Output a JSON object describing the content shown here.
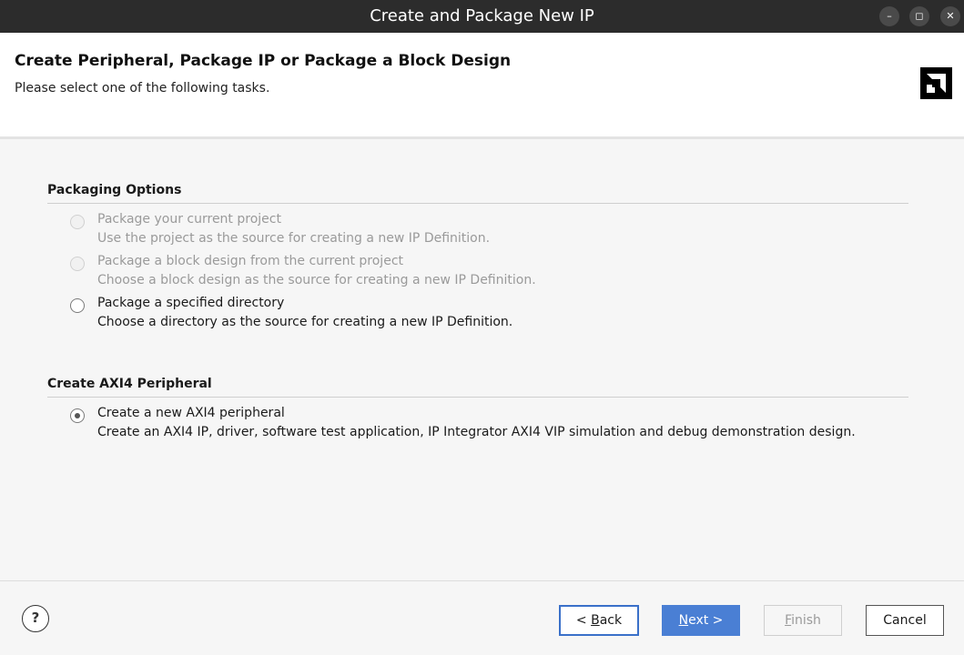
{
  "window": {
    "title": "Create and Package New IP",
    "controls": [
      "minimize",
      "maximize",
      "close"
    ]
  },
  "header": {
    "title": "Create Peripheral, Package IP or Package a Block Design",
    "subtitle": "Please select one of the following tasks.",
    "logo": "amd-logo"
  },
  "sections": [
    {
      "title": "Packaging Options",
      "options": [
        {
          "label": "Package your current project",
          "description": "Use the project as the source for creating a new IP Definition.",
          "enabled": false,
          "selected": false
        },
        {
          "label": "Package a block design from the current project",
          "description": "Choose a block design as the source for creating a new IP Definition.",
          "enabled": false,
          "selected": false
        },
        {
          "label": "Package a specified directory",
          "description": "Choose a directory as the source for creating a new IP Definition.",
          "enabled": true,
          "selected": false
        }
      ]
    },
    {
      "title": "Create AXI4 Peripheral",
      "options": [
        {
          "label": "Create a new AXI4 peripheral",
          "description": "Create an AXI4 IP, driver, software test application, IP Integrator AXI4 VIP simulation and debug demonstration design.",
          "enabled": true,
          "selected": true
        }
      ]
    }
  ],
  "footer": {
    "help_label": "?",
    "back_prefix": "< ",
    "back_mnemonic": "B",
    "back_rest": "ack",
    "next_mnemonic": "N",
    "next_rest": "ext >",
    "finish_mnemonic": "F",
    "finish_rest": "inish",
    "cancel_label": "Cancel"
  },
  "colors": {
    "titlebar": "#2c2c2c",
    "accent": "#4a7fd4",
    "background": "#f6f6f6"
  }
}
